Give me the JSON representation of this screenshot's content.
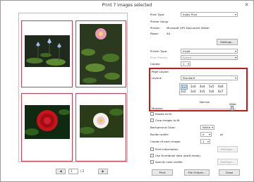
{
  "window": {
    "title": "Print  7 images selected",
    "close": "✕"
  },
  "nav": {
    "prev": "◀",
    "page": "1",
    "of": "/  2",
    "next": "▶"
  },
  "printer": {
    "print_type_label": "Print Type:",
    "print_type": "Index Print",
    "setup_label": "Printer Setup",
    "printer_label": "Printer:",
    "printer": "Microsoft XPS Document Writer",
    "paper_label": "Paper:",
    "paper": "A4",
    "settings1": "Settings...",
    "printer_type_label": "Printer Type:",
    "printer_type": "Inkjet",
    "priority_label": "Print Priority:",
    "priority": "Speed",
    "copies_label": "Copies:",
    "copies": "1"
  },
  "layout": {
    "group": "Page Layout",
    "layout_label": "Layout:",
    "layout": "Standard",
    "grid": [
      [
        "1x2",
        "2x4",
        "4x4",
        "5x5",
        "6x6"
      ],
      [
        "2x2",
        "3x4",
        "4x5",
        "5x6",
        "6x7"
      ]
    ],
    "narrow": "Narrow",
    "wide": "Wide",
    "margins": "Margins:"
  },
  "options": {
    "rotate": "Rotate to fit",
    "crop": "Crop images to fit",
    "bg_label": "Background Color:",
    "bg": "White",
    "border_label": "Border width:",
    "border": "0",
    "border_unit": "pt",
    "copies_each_label": "Copies of each image:",
    "copies_each": "1",
    "print_info": "Print Information",
    "settings2": "Settings...",
    "thumb": "Use thumbnail data (draft mode)",
    "color_profile": "Specify color profile",
    "settings3": "Settings..."
  },
  "actions": {
    "print": "Print",
    "output": "File Output...",
    "close": "Close"
  }
}
